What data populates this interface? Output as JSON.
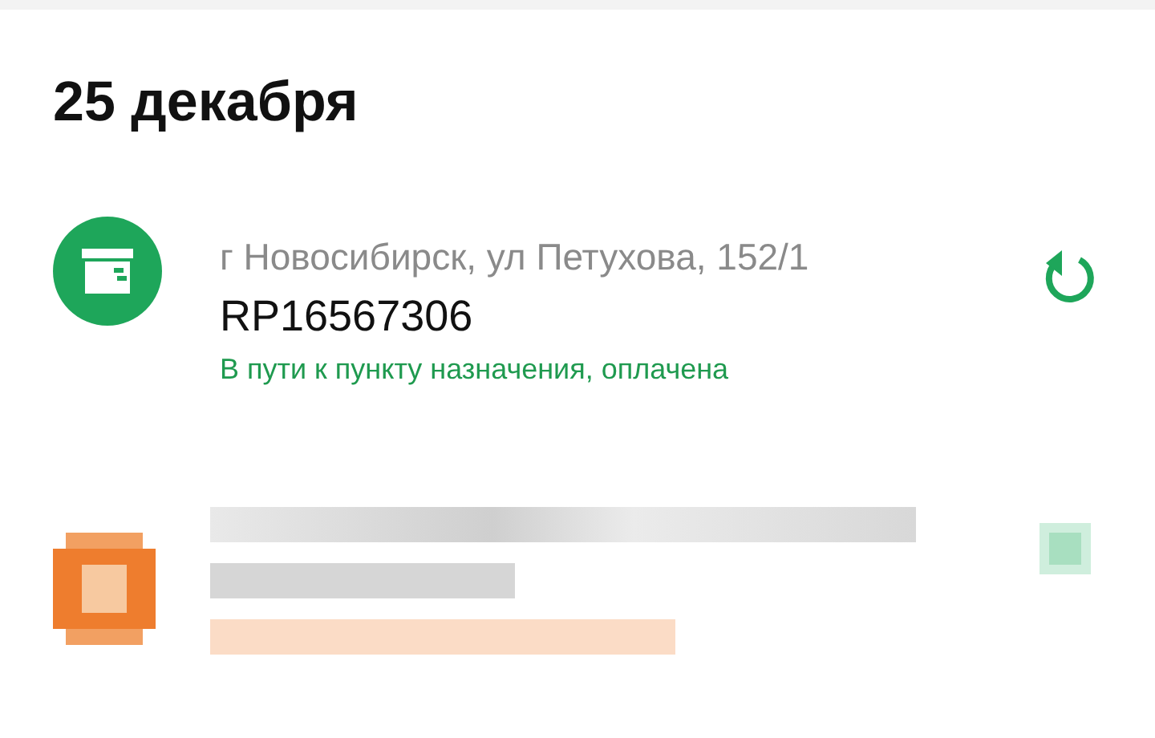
{
  "date_heading": "25 декабря",
  "shipments": [
    {
      "kind": "parcel",
      "address": "г Новосибирск, ул Петухова, 152/1",
      "number": "RP16567306",
      "status": "В пути к пункту назначения, оплачена"
    },
    {
      "kind": "redacted"
    }
  ]
}
